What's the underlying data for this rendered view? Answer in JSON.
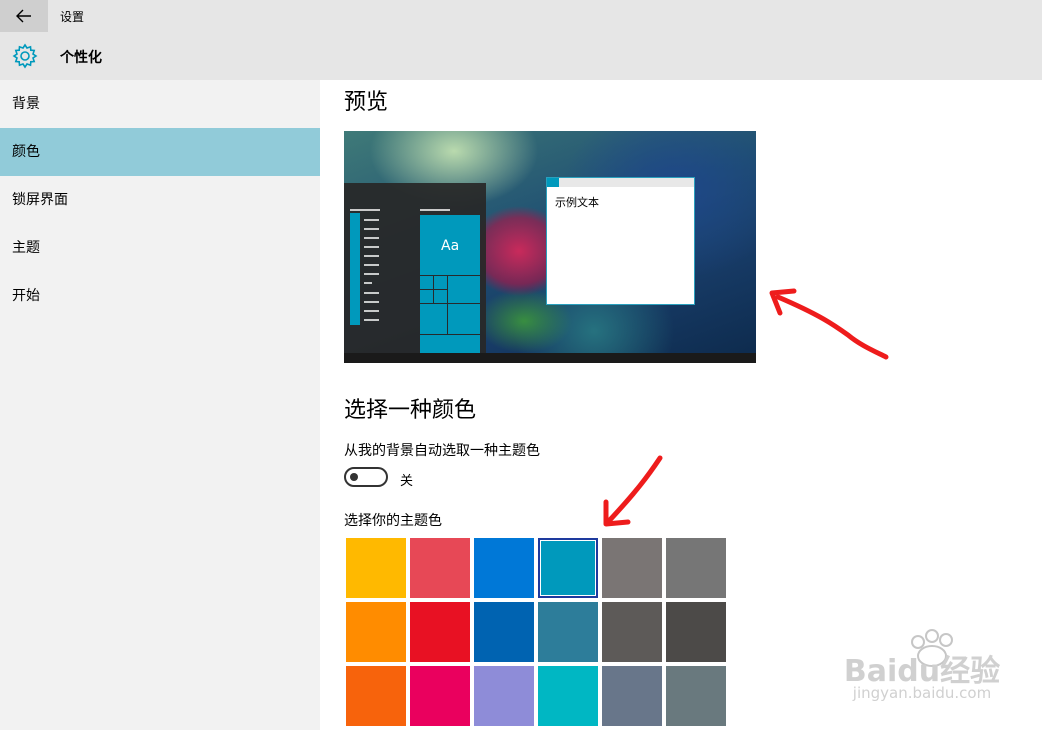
{
  "window": {
    "title": "设置"
  },
  "header": {
    "page_title": "个性化"
  },
  "sidebar": {
    "items": [
      {
        "label": "背景"
      },
      {
        "label": "颜色"
      },
      {
        "label": "锁屏界面"
      },
      {
        "label": "主题"
      },
      {
        "label": "开始"
      }
    ],
    "active_index": 1,
    "active_color": "#91cbd9"
  },
  "preview": {
    "heading": "预览",
    "tile_text": "Aa",
    "window_sample_text": "示例文本"
  },
  "color_section": {
    "heading": "选择一种颜色",
    "auto_pick_label": "从我的背景自动选取一种主题色",
    "toggle_state": "关",
    "choose_label": "选择你的主题色",
    "swatches": [
      "#ffb900",
      "#e74856",
      "#0078d7",
      "#0099bc",
      "#7a7574",
      "#767676",
      "#ff8c00",
      "#e81123",
      "#0063b1",
      "#2d7d9a",
      "#5d5a58",
      "#4c4a48",
      "#f7630c",
      "#ea005e",
      "#8e8cd8",
      "#00b7c3",
      "#68768a",
      "#69797e"
    ],
    "selected_swatch": "#0099bc"
  },
  "accent_color": "#0099bc",
  "watermark": {
    "brand": "Baidu经验",
    "url": "jingyan.baidu.com"
  }
}
